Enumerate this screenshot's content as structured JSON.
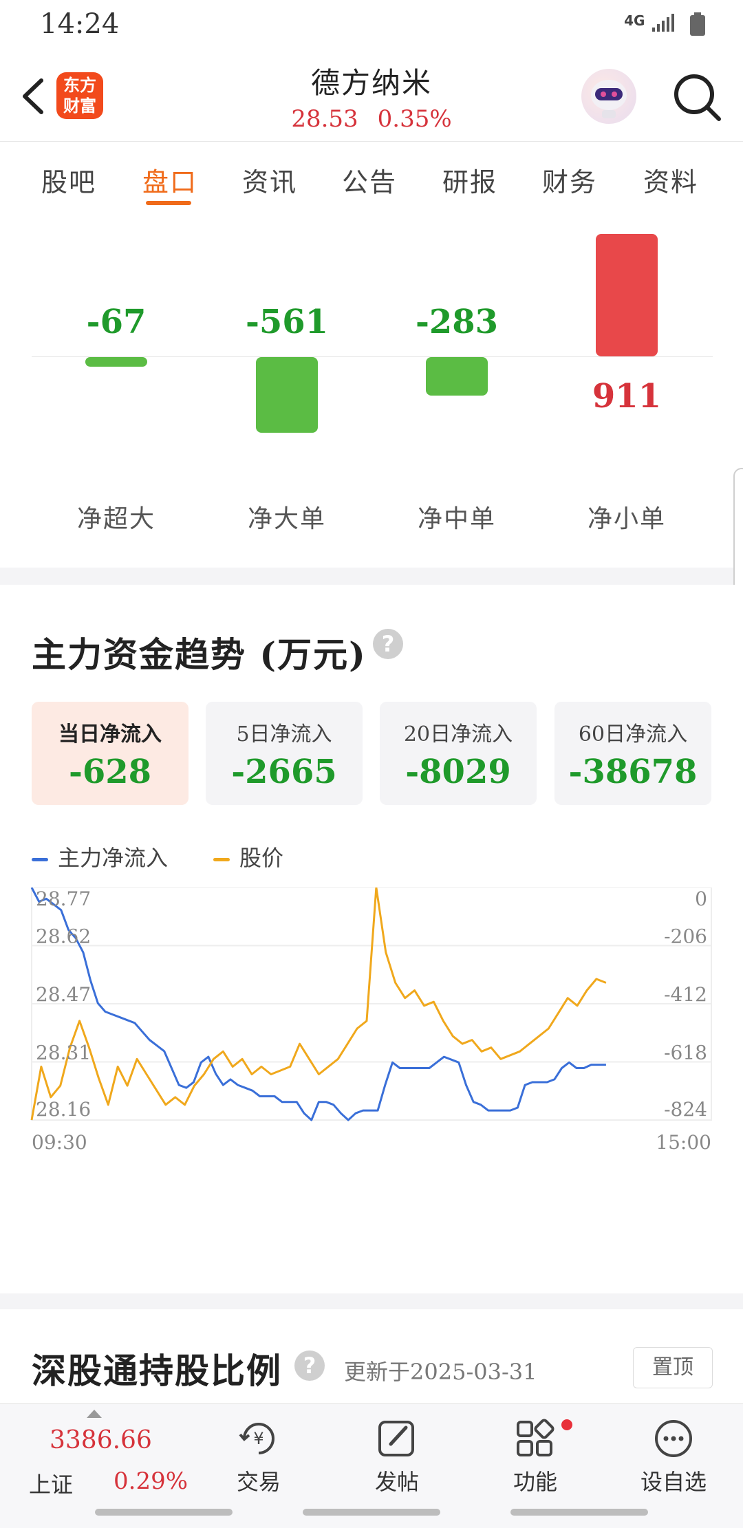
{
  "status_bar": {
    "time": "14:24",
    "network": "4G"
  },
  "header": {
    "logo_text": "东方财富",
    "stock_name": "德方纳米",
    "price": "28.53",
    "change_pct": "0.35%"
  },
  "tabs": [
    {
      "label": "股吧",
      "active": false
    },
    {
      "label": "盘口",
      "active": true
    },
    {
      "label": "资讯",
      "active": false
    },
    {
      "label": "公告",
      "active": false
    },
    {
      "label": "研报",
      "active": false
    },
    {
      "label": "财务",
      "active": false
    },
    {
      "label": "资料",
      "active": false
    }
  ],
  "net_flow_bars": [
    {
      "label": "净超大",
      "value": "-67"
    },
    {
      "label": "净大单",
      "value": "-561"
    },
    {
      "label": "净中单",
      "value": "-283"
    },
    {
      "label": "净小单",
      "value": "911"
    }
  ],
  "trend_section": {
    "title": "主力资金趋势 (万元)",
    "help": "?",
    "cards": [
      {
        "label": "当日净流入",
        "value": "-628",
        "active": true
      },
      {
        "label": "5日净流入",
        "value": "-2665",
        "active": false
      },
      {
        "label": "20日净流入",
        "value": "-8029",
        "active": false
      },
      {
        "label": "60日净流入",
        "value": "-38678",
        "active": false
      }
    ],
    "legend": [
      {
        "name": "主力净流入",
        "color": "#3a6fd8"
      },
      {
        "name": "股价",
        "color": "#f0a81c"
      }
    ]
  },
  "chart_data": {
    "type": "line",
    "x_start_label": "09:30",
    "x_end_label": "15:00",
    "left_axis_ticks": [
      "28.77",
      "28.62",
      "28.47",
      "28.31",
      "28.16"
    ],
    "right_axis_ticks": [
      "0",
      "-206",
      "-412",
      "-618",
      "-824"
    ],
    "left_ylim": [
      28.16,
      28.77
    ],
    "right_ylim": [
      -824,
      0
    ],
    "series": [
      {
        "name": "主力净流入",
        "axis": "right",
        "color": "#3a6fd8",
        "values": [
          0,
          -50,
          -40,
          -60,
          -80,
          -150,
          -180,
          -230,
          -330,
          -410,
          -440,
          -450,
          -460,
          -470,
          -480,
          -510,
          -540,
          -560,
          -580,
          -640,
          -700,
          -710,
          -690,
          -620,
          -600,
          -660,
          -700,
          -680,
          -700,
          -710,
          -720,
          -740,
          -740,
          -740,
          -760,
          -760,
          -760,
          -800,
          -824,
          -760,
          -760,
          -770,
          -800,
          -824,
          -800,
          -790,
          -790,
          -790,
          -700,
          -620,
          -640,
          -640,
          -640,
          -640,
          -640,
          -620,
          -600,
          -610,
          -620,
          -700,
          -760,
          -770,
          -790,
          -790,
          -790,
          -790,
          -780,
          -700,
          -690,
          -690,
          -690,
          -680,
          -640,
          -620,
          -640,
          -640,
          -628,
          -628,
          -628
        ]
      },
      {
        "name": "股价",
        "axis": "left",
        "color": "#f0a81c",
        "values": [
          28.16,
          28.3,
          28.22,
          28.25,
          28.35,
          28.42,
          28.35,
          28.27,
          28.2,
          28.3,
          28.25,
          28.32,
          28.28,
          28.24,
          28.2,
          28.22,
          28.2,
          28.25,
          28.28,
          28.32,
          28.34,
          28.3,
          28.32,
          28.28,
          28.3,
          28.28,
          28.29,
          28.3,
          28.36,
          28.32,
          28.28,
          28.3,
          28.32,
          28.36,
          28.4,
          28.42,
          28.77,
          28.6,
          28.52,
          28.48,
          28.5,
          28.46,
          28.47,
          28.42,
          28.38,
          28.36,
          28.37,
          28.34,
          28.35,
          28.32,
          28.33,
          28.34,
          28.36,
          28.38,
          28.4,
          28.44,
          28.48,
          28.46,
          28.5,
          28.53,
          28.52
        ]
      }
    ]
  },
  "holding_section": {
    "title": "深股通持股比例",
    "help": "?",
    "update_text": "更新于2025-03-31",
    "pin_label": "置顶"
  },
  "bottom_nav": {
    "index_value": "3386.66",
    "index_name": "上证",
    "index_pct": "0.29%",
    "items": [
      {
        "label": "交易"
      },
      {
        "label": "发帖"
      },
      {
        "label": "功能"
      },
      {
        "label": "设自选"
      }
    ]
  }
}
